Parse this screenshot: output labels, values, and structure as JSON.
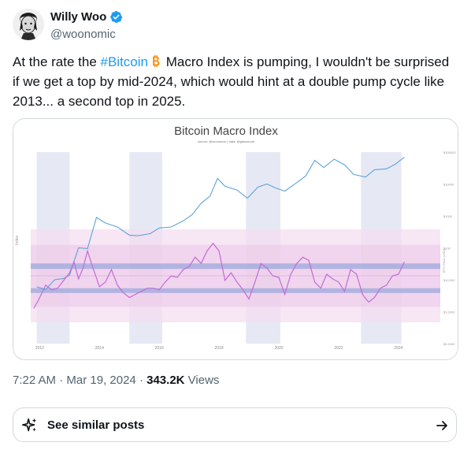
{
  "author": {
    "name": "Willy Woo",
    "handle": "@woonomic"
  },
  "tweet": {
    "text_before": "At the rate the ",
    "hashtag": "#Bitcoin",
    "text_after": " Macro Index is pumping, I wouldn't be surprised if we get a top by mid-2024, which would hint at a double pump cycle like 2013... a second top in 2025."
  },
  "meta": {
    "time": "7:22 AM",
    "sep1": " · ",
    "date": "Mar 19, 2024",
    "sep2": " · ",
    "views": "343.2K",
    "views_label": " Views"
  },
  "similar": {
    "label": "See similar posts"
  },
  "colors": {
    "link": "#1d9bf0",
    "price_line": "#5ea3d6",
    "index_line": "#c06cd6",
    "band": "#8fa3d9"
  },
  "chart_data": {
    "type": "line",
    "title": "Bitcoin Macro Index",
    "subtitle": "source: @woonomic | data: @glassnode",
    "ylabel": "Index",
    "ylabel_right": "BTC Price (USD)",
    "x_ticks": [
      "2012",
      "2014",
      "2016",
      "2018",
      "2020",
      "2022",
      "2024"
    ],
    "y_ticks_right": [
      "$100000",
      "$10000",
      "$1000",
      "$100",
      "$10.000",
      "$1.0000",
      "$0.1000"
    ],
    "series": [
      {
        "name": "BTC Price (USD)",
        "x": [
          2011.9,
          2012.2,
          2012.5,
          2012.8,
          2013.0,
          2013.3,
          2013.6,
          2013.9,
          2014.2,
          2014.6,
          2015.0,
          2015.3,
          2015.7,
          2016.0,
          2016.4,
          2016.8,
          2017.1,
          2017.4,
          2017.7,
          2017.95,
          2018.2,
          2018.6,
          2018.95,
          2019.3,
          2019.6,
          2019.9,
          2020.2,
          2020.5,
          2020.9,
          2021.2,
          2021.5,
          2021.85,
          2022.2,
          2022.5,
          2022.9,
          2023.2,
          2023.6,
          2023.9,
          2024.2
        ],
        "y": [
          6,
          5,
          10,
          11,
          14,
          100,
          95,
          900,
          600,
          450,
          250,
          240,
          280,
          420,
          450,
          700,
          1100,
          2500,
          4200,
          15000,
          8500,
          6500,
          3600,
          8000,
          10000,
          7500,
          6000,
          9500,
          18000,
          55000,
          33000,
          60000,
          40000,
          20000,
          16500,
          28000,
          30000,
          42000,
          70000
        ]
      },
      {
        "name": "Index",
        "x": [
          2011.8,
          2011.95,
          2012.2,
          2012.4,
          2012.6,
          2012.8,
          2013.0,
          2013.15,
          2013.3,
          2013.45,
          2013.6,
          2013.8,
          2014.0,
          2014.2,
          2014.4,
          2014.6,
          2014.8,
          2015.0,
          2015.2,
          2015.4,
          2015.6,
          2015.8,
          2016.0,
          2016.2,
          2016.4,
          2016.6,
          2016.8,
          2017.0,
          2017.2,
          2017.4,
          2017.6,
          2017.8,
          2018.0,
          2018.2,
          2018.4,
          2018.6,
          2018.8,
          2019.0,
          2019.2,
          2019.4,
          2019.6,
          2019.8,
          2020.0,
          2020.2,
          2020.4,
          2020.6,
          2020.8,
          2021.0,
          2021.2,
          2021.4,
          2021.6,
          2021.8,
          2022.0,
          2022.2,
          2022.4,
          2022.6,
          2022.8,
          2023.0,
          2023.2,
          2023.4,
          2023.6,
          2023.8,
          2024.0,
          2024.2
        ],
        "y": [
          -0.55,
          -0.3,
          0.2,
          0.05,
          0.1,
          0.35,
          0.6,
          0.95,
          0.4,
          0.75,
          1.3,
          0.7,
          0.15,
          0.3,
          0.7,
          0.2,
          -0.05,
          -0.2,
          -0.1,
          0.0,
          0.1,
          0.1,
          0.05,
          0.3,
          0.5,
          0.45,
          0.7,
          0.8,
          1.1,
          0.9,
          1.3,
          1.55,
          1.3,
          0.35,
          0.6,
          0.3,
          0.05,
          -0.25,
          0.3,
          0.9,
          0.75,
          0.5,
          0.45,
          -0.1,
          0.55,
          0.9,
          1.1,
          1.0,
          0.3,
          0.1,
          0.55,
          0.4,
          0.3,
          0.0,
          0.7,
          0.55,
          -0.1,
          -0.35,
          -0.2,
          0.1,
          0.2,
          0.5,
          0.55,
          0.95
        ]
      }
    ]
  }
}
